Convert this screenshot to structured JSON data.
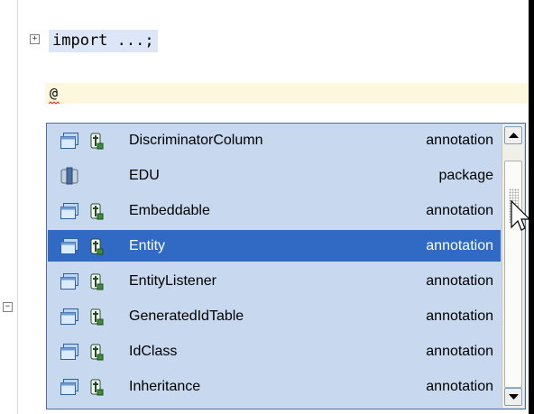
{
  "editor": {
    "import_line": "import ...;",
    "current_line_text": "@",
    "fold_import_glyph": "+",
    "fold_class_glyph": "−"
  },
  "completion": {
    "items": [
      {
        "name": "DiscriminatorColumn",
        "kind": "annotation",
        "icon": "annotation-type-icon",
        "selected": false
      },
      {
        "name": "EDU",
        "kind": "package",
        "icon": "package-icon",
        "selected": false
      },
      {
        "name": "Embeddable",
        "kind": "annotation",
        "icon": "annotation-type-icon",
        "selected": false
      },
      {
        "name": "Entity",
        "kind": "annotation",
        "icon": "annotation-type-icon",
        "selected": true
      },
      {
        "name": "EntityListener",
        "kind": "annotation",
        "icon": "annotation-type-icon",
        "selected": false
      },
      {
        "name": "GeneratedIdTable",
        "kind": "annotation",
        "icon": "annotation-type-icon",
        "selected": false
      },
      {
        "name": "IdClass",
        "kind": "annotation",
        "icon": "annotation-type-icon",
        "selected": false
      },
      {
        "name": "Inheritance",
        "kind": "annotation",
        "icon": "annotation-type-icon",
        "selected": false
      }
    ],
    "scroll_position": 0.1
  },
  "colors": {
    "popup_bg": "#c7d8ef",
    "selection": "#316ac5",
    "current_line": "#fdf7dd",
    "import_highlight": "#dce6f6",
    "error_underline": "#e03030",
    "annotation_badge": "#3c8c3c"
  }
}
